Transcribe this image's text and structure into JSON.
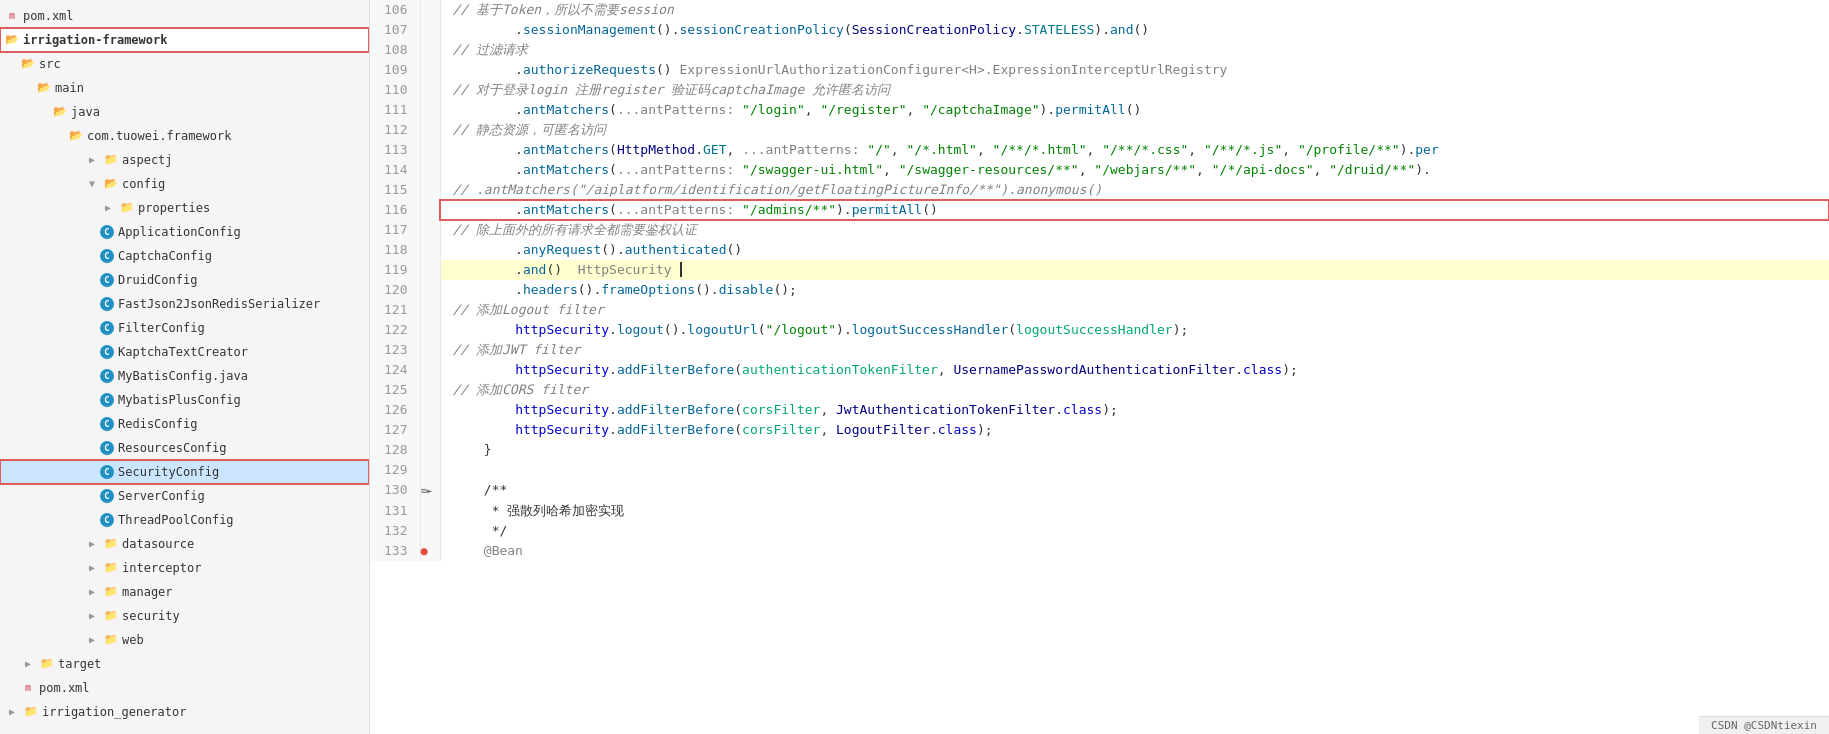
{
  "fileTree": {
    "items": [
      {
        "id": "pom-xml-top",
        "label": "pom.xml",
        "type": "xml",
        "indent": 0
      },
      {
        "id": "irrigation-framework",
        "label": "irrigation-framework",
        "type": "folder-open",
        "indent": 0,
        "highlighted": true
      },
      {
        "id": "src",
        "label": "src",
        "type": "folder-open",
        "indent": 1
      },
      {
        "id": "main",
        "label": "main",
        "type": "folder-open",
        "indent": 2
      },
      {
        "id": "java",
        "label": "java",
        "type": "folder-open",
        "indent": 3
      },
      {
        "id": "com-tuowei",
        "label": "com.tuowei.framework",
        "type": "folder-open",
        "indent": 4
      },
      {
        "id": "aspectj",
        "label": "aspectj",
        "type": "folder",
        "indent": 5
      },
      {
        "id": "config",
        "label": "config",
        "type": "folder-open",
        "indent": 5
      },
      {
        "id": "properties",
        "label": "properties",
        "type": "folder",
        "indent": 6
      },
      {
        "id": "ApplicationConfig",
        "label": "ApplicationConfig",
        "type": "java",
        "indent": 6
      },
      {
        "id": "CaptchaConfig",
        "label": "CaptchaConfig",
        "type": "java",
        "indent": 6
      },
      {
        "id": "DruidConfig",
        "label": "DruidConfig",
        "type": "java",
        "indent": 6
      },
      {
        "id": "FastJson2JsonRedisSerializer",
        "label": "FastJson2JsonRedisSerializer",
        "type": "java",
        "indent": 6
      },
      {
        "id": "FilterConfig",
        "label": "FilterConfig",
        "type": "java",
        "indent": 6
      },
      {
        "id": "KaptchaTextCreator",
        "label": "KaptchaTextCreator",
        "type": "java",
        "indent": 6
      },
      {
        "id": "MyBatisConfig",
        "label": "MyBatisConfig.java",
        "type": "java",
        "indent": 6
      },
      {
        "id": "MybatisPlusConfig",
        "label": "MybatisPlusConfig",
        "type": "java",
        "indent": 6
      },
      {
        "id": "RedisConfig",
        "label": "RedisConfig",
        "type": "java",
        "indent": 6
      },
      {
        "id": "ResourcesConfig",
        "label": "ResourcesConfig",
        "type": "java",
        "indent": 6
      },
      {
        "id": "SecurityConfig",
        "label": "SecurityConfig",
        "type": "java",
        "indent": 6,
        "selected": true,
        "highlighted": true
      },
      {
        "id": "ServerConfig",
        "label": "ServerConfig",
        "type": "java",
        "indent": 6
      },
      {
        "id": "ThreadPoolConfig",
        "label": "ThreadPoolConfig",
        "type": "java",
        "indent": 6
      },
      {
        "id": "datasource",
        "label": "datasource",
        "type": "folder",
        "indent": 5
      },
      {
        "id": "interceptor",
        "label": "interceptor",
        "type": "folder",
        "indent": 5
      },
      {
        "id": "manager",
        "label": "manager",
        "type": "folder",
        "indent": 5
      },
      {
        "id": "security",
        "label": "security",
        "type": "folder",
        "indent": 5
      },
      {
        "id": "web",
        "label": "web",
        "type": "folder",
        "indent": 5
      },
      {
        "id": "target",
        "label": "target",
        "type": "folder",
        "indent": 1
      },
      {
        "id": "pom-xml-bot",
        "label": "pom.xml",
        "type": "xml",
        "indent": 1
      },
      {
        "id": "irrigation-generator",
        "label": "irrigation_generator",
        "type": "folder-open",
        "indent": 0
      }
    ]
  },
  "codeLines": [
    {
      "num": 106,
      "gutter": "",
      "content": "// 基于Token，所以不需要session",
      "type": "comment"
    },
    {
      "num": 107,
      "gutter": "",
      "content": "        .sessionManagement().sessionCreationPolicy(SessionCreationPolicy.STATELESS).and()",
      "type": "code"
    },
    {
      "num": 108,
      "gutter": "",
      "content": "// 过滤请求",
      "type": "comment"
    },
    {
      "num": 109,
      "gutter": "",
      "content": "        .authorizeRequests() ExpressionUrlAuthorizationConfigurer<H>.ExpressionInterceptUrlRegistry",
      "type": "code-hint"
    },
    {
      "num": 110,
      "gutter": "",
      "content": "// 对于登录login 注册register 验证码captchaImage 允许匿名访问",
      "type": "comment"
    },
    {
      "num": 111,
      "gutter": "",
      "content": "        .antMatchers(...antPatterns: \"/login\", \"/register\", \"/captchaImage\").permitAll()",
      "type": "code"
    },
    {
      "num": 112,
      "gutter": "",
      "content": "// 静态资源，可匿名访问",
      "type": "comment"
    },
    {
      "num": 113,
      "gutter": "",
      "content": "        .antMatchers(HttpMethod.GET, ...antPatterns: \"/\", \"/*.html\", \"/**/*.html\", \"/**/*.css\", \"/**/*.js\", \"/profile/**\").per",
      "type": "code"
    },
    {
      "num": 114,
      "gutter": "",
      "content": "        .antMatchers(...antPatterns: \"/swagger-ui.html\", \"/swagger-resources/**\", \"/webjars/**\", \"/*/api-docs\", \"/druid/**\").",
      "type": "code"
    },
    {
      "num": 115,
      "gutter": "",
      "content": "// .antMatchers(\"/aiplatform/identification/getFloatingPictureInfo/**\").anonymous()",
      "type": "comment"
    },
    {
      "num": 116,
      "gutter": "",
      "content": "        .antMatchers(...antPatterns: \"/admins/**\").permitAll()",
      "type": "code",
      "outlined": true
    },
    {
      "num": 117,
      "gutter": "",
      "content": "// 除上面外的所有请求全都需要鉴权认证",
      "type": "comment"
    },
    {
      "num": 118,
      "gutter": "",
      "content": "        .anyRequest().authenticated()",
      "type": "code"
    },
    {
      "num": 119,
      "gutter": "",
      "content": "        .and()  HttpSecurity |",
      "type": "code-hint",
      "highlighted": true
    },
    {
      "num": 120,
      "gutter": "",
      "content": "        .headers().frameOptions().disable();",
      "type": "code"
    },
    {
      "num": 121,
      "gutter": "",
      "content": "// 添加Logout filter",
      "type": "comment"
    },
    {
      "num": 122,
      "gutter": "",
      "content": "        httpSecurity.logout().logoutUrl(\"/logout\").logoutSuccessHandler(logoutSuccessHandler);",
      "type": "code"
    },
    {
      "num": 123,
      "gutter": "",
      "content": "// 添加JWT filter",
      "type": "comment"
    },
    {
      "num": 124,
      "gutter": "",
      "content": "        httpSecurity.addFilterBefore(authenticationTokenFilter, UsernamePasswordAuthenticationFilter.class);",
      "type": "code"
    },
    {
      "num": 125,
      "gutter": "",
      "content": "// 添加CORS filter",
      "type": "comment"
    },
    {
      "num": 126,
      "gutter": "",
      "content": "        httpSecurity.addFilterBefore(corsFilter, JwtAuthenticationTokenFilter.class);",
      "type": "code"
    },
    {
      "num": 127,
      "gutter": "",
      "content": "        httpSecurity.addFilterBefore(corsFilter, LogoutFilter.class);",
      "type": "code"
    },
    {
      "num": 128,
      "gutter": "",
      "content": "    }",
      "type": "code"
    },
    {
      "num": 129,
      "gutter": "",
      "content": "",
      "type": "code"
    },
    {
      "num": 130,
      "gutter": "≡►",
      "content": "    /**",
      "type": "code"
    },
    {
      "num": 131,
      "gutter": "",
      "content": "     * 强散列哈希加密实现",
      "type": "code"
    },
    {
      "num": 132,
      "gutter": "",
      "content": "     */",
      "type": "code"
    },
    {
      "num": 133,
      "gutter": "🔴",
      "content": "    @Bean",
      "type": "code"
    }
  ],
  "statusBar": {
    "text": "CSDN @CSDNtiexin"
  }
}
